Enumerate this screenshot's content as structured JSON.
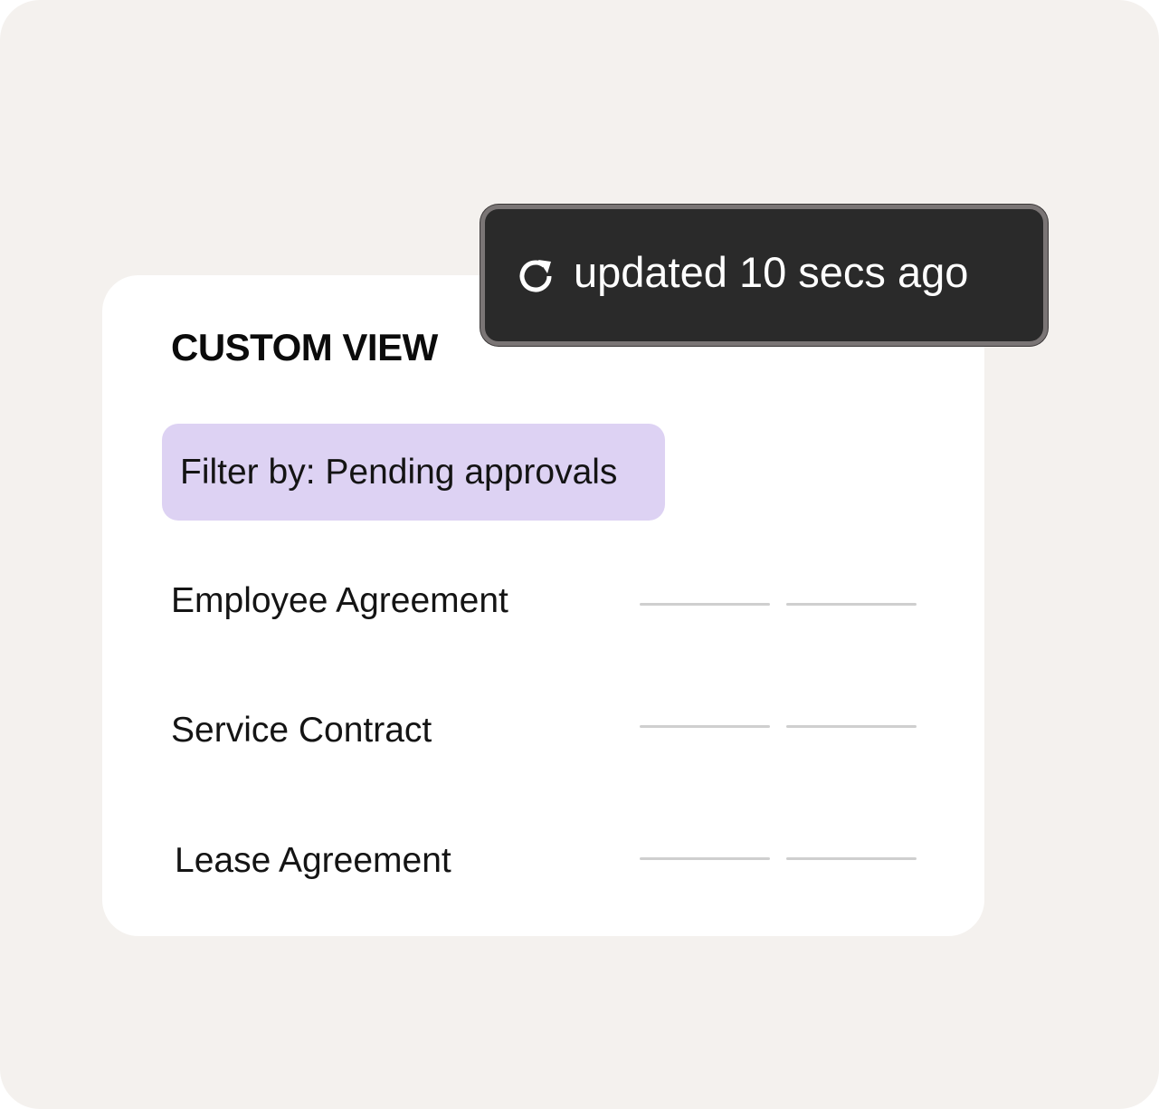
{
  "card": {
    "title": "CUSTOM VIEW",
    "filter_label": "Filter by: Pending approvals"
  },
  "documents": [
    {
      "name": "Employee Agreement"
    },
    {
      "name": "Service Contract"
    },
    {
      "name": "Lease Agreement"
    }
  ],
  "toast": {
    "icon": "refresh-icon",
    "text": "updated 10 secs ago"
  },
  "colors": {
    "background": "#f4f1ee",
    "card": "#ffffff",
    "filter_chip": "#ddd2f3",
    "toast_bg": "#2a2a2a",
    "toast_border": "#7a7575",
    "placeholder_line": "#cfcfcf"
  }
}
